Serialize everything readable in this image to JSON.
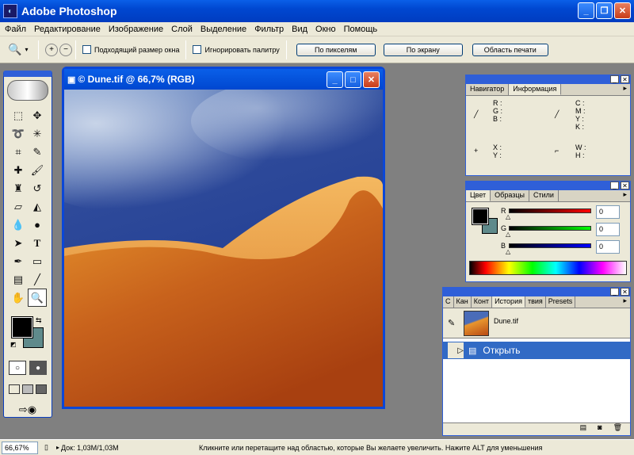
{
  "app": {
    "title": "Adobe Photoshop"
  },
  "menu": [
    "Файл",
    "Редактирование",
    "Изображение",
    "Слой",
    "Выделение",
    "Фильтр",
    "Вид",
    "Окно",
    "Помощь"
  ],
  "options": {
    "resize_windows": "Подходящий размер окна",
    "ignore_palettes": "Игнорировать палитру",
    "actual_pixels": "По пикселям",
    "fit_screen": "По экрану",
    "print_size": "Область печати"
  },
  "document": {
    "title": "© Dune.tif @ 66,7% (RGB)"
  },
  "info_panel": {
    "tabs": [
      "Навигатор",
      "Информация"
    ],
    "rgb_labels": [
      "R :",
      "G :",
      "B :"
    ],
    "cmyk_labels": [
      "C :",
      "M :",
      "Y :",
      "K :"
    ],
    "xy_labels": [
      "X :",
      "Y :"
    ],
    "wh_labels": [
      "W :",
      "H :"
    ]
  },
  "color_panel": {
    "tabs": [
      "Цвет",
      "Образцы",
      "Стили"
    ],
    "channels": [
      {
        "label": "R",
        "value": "0",
        "color": "#e00000"
      },
      {
        "label": "G",
        "value": "0",
        "color": "#00c000"
      },
      {
        "label": "B",
        "value": "0",
        "color": "#0000e0"
      }
    ]
  },
  "history_panel": {
    "tabs": [
      "С",
      "Кан",
      "Конт",
      "История",
      "твия",
      "Presets"
    ],
    "snapshot": "Dune.tif",
    "steps": [
      "Открыть"
    ]
  },
  "status": {
    "zoom": "66,67%",
    "doc": "Док: 1,03M/1,03M",
    "hint": "Кликните или перетащите над областью, которые Вы желаете увеличить. Нажите ALT для уменьшения"
  },
  "colors": {
    "foreground": "#000000",
    "background": "#5f8a8b",
    "titlebar": "#0047d0"
  }
}
